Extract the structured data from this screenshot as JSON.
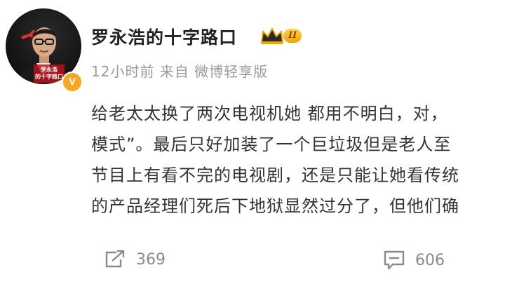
{
  "post": {
    "author": {
      "name": "罗永浩的十字路口",
      "avatar_caption_line1": "罗永浩",
      "avatar_caption_line2": "的十字路口",
      "member_level": "II",
      "verified_mark": "V"
    },
    "meta": "12小时前 来自 微博轻享版",
    "body_lines": [
      "给老太太换了两次电视机她 都用不明白，对，",
      "模式”。最后只好加装了一个巨垃圾但是老人至",
      "节目上有看不完的电视剧，还是只能让她看传统",
      "的产品经理们死后下地狱显然过分了，但他们确"
    ],
    "actions": {
      "share_count": "369",
      "comment_count": "606",
      "share_icon": "share-icon",
      "comment_icon": "comment-icon"
    },
    "colors": {
      "meta_text": "#9a9a9a",
      "badge_gold": "#f5a623"
    }
  }
}
